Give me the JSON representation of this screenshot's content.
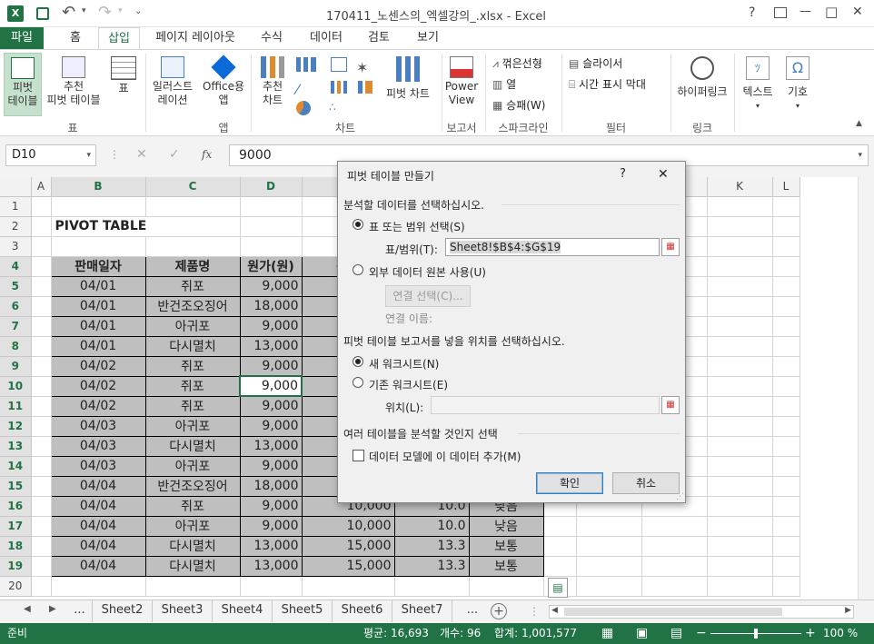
{
  "title_bar": {
    "title": "170411_노센스의_엑셀강의_.xlsx - Excel",
    "help": "?",
    "min": "—",
    "restore": "□",
    "close": "✕"
  },
  "ribbon_tabs": [
    "파일",
    "홈",
    "삽입",
    "페이지 레이아웃",
    "수식",
    "데이터",
    "검토",
    "보기"
  ],
  "ribbon": {
    "pivot_table": [
      "피벗",
      "테이블"
    ],
    "recommended_pivot": [
      "추천",
      "피벗 테이블"
    ],
    "table": "표",
    "illustrations": [
      "일러스트",
      "레이션"
    ],
    "office_apps": [
      "Office용",
      "앱"
    ],
    "recommended_charts": [
      "추천",
      "차트"
    ],
    "pivot_chart": "피벗 차트",
    "power_view": [
      "Power",
      "View"
    ],
    "spark_line": "꺾은선형",
    "spark_column": "열",
    "spark_winloss": "승패(W)",
    "slicer": "슬라이서",
    "timeline": "시간 표시 막대",
    "hyperlink": "하이퍼링크",
    "text": "텍스트",
    "symbol": "기호",
    "group_table": "표",
    "group_apps": "앱",
    "group_charts": "차트",
    "group_reports": "보고서",
    "group_sparklines": "스파크라인",
    "group_filters": "필터",
    "group_links": "링크"
  },
  "formula_bar": {
    "name_box": "D10",
    "fx": "fx",
    "value": "9000"
  },
  "columns": [
    "A",
    "B",
    "C",
    "D",
    "E",
    "F",
    "G",
    "H",
    "I",
    "J",
    "K",
    "L"
  ],
  "rows": [
    "1",
    "2",
    "3",
    "4",
    "5",
    "6",
    "7",
    "8",
    "9",
    "10",
    "11",
    "12",
    "13",
    "14",
    "15",
    "16",
    "17",
    "18",
    "19",
    "20"
  ],
  "sheet_title": "PIVOT TABLE",
  "table_headers": [
    "판매일자",
    "제품명",
    "원가(원)",
    "판매",
    "",
    ""
  ],
  "table_rows": [
    [
      "04/01",
      "쥐포",
      "9,000",
      "",
      "",
      ""
    ],
    [
      "04/01",
      "반건조오징어",
      "18,000",
      "",
      "",
      ""
    ],
    [
      "04/01",
      "아귀포",
      "9,000",
      "",
      "",
      ""
    ],
    [
      "04/01",
      "다시멸치",
      "13,000",
      "",
      "",
      ""
    ],
    [
      "04/02",
      "쥐포",
      "9,000",
      "",
      "",
      ""
    ],
    [
      "04/02",
      "쥐포",
      "9,000",
      "",
      "",
      ""
    ],
    [
      "04/02",
      "쥐포",
      "9,000",
      "",
      "",
      ""
    ],
    [
      "04/03",
      "아귀포",
      "9,000",
      "",
      "",
      ""
    ],
    [
      "04/03",
      "다시멸치",
      "13,000",
      "",
      "",
      ""
    ],
    [
      "04/03",
      "아귀포",
      "9,000",
      "",
      "",
      ""
    ],
    [
      "04/04",
      "반건조오징어",
      "18,000",
      "",
      "",
      ""
    ],
    [
      "04/04",
      "쥐포",
      "9,000",
      "10,000",
      "10.0",
      "낮음"
    ],
    [
      "04/04",
      "아귀포",
      "9,000",
      "10,000",
      "10.0",
      "낮음"
    ],
    [
      "04/04",
      "다시멸치",
      "13,000",
      "15,000",
      "13.3",
      "보통"
    ],
    [
      "04/04",
      "다시멸치",
      "13,000",
      "15,000",
      "13.3",
      "보통"
    ]
  ],
  "sheet_tabs": [
    "...",
    "Sheet2",
    "Sheet3",
    "Sheet4",
    "Sheet5",
    "Sheet6",
    "Sheet7",
    "..."
  ],
  "status_bar": {
    "ready": "준비",
    "average": "평균: 16,693",
    "count": "개수: 96",
    "sum": "합계: 1,001,577",
    "zoom": "100 %"
  },
  "dialog": {
    "title": "피벗 테이블 만들기",
    "help": "?",
    "close": "✕",
    "section1": "분석할 데이터를 선택하십시오.",
    "opt_range": "표 또는 범위 선택(S)",
    "range_label": "표/범위(T):",
    "range_value": "Sheet8!$B$4:$G$19",
    "opt_external": "외부 데이터 원본 사용(U)",
    "choose_conn": "연결 선택(C)...",
    "conn_name": "연결 이름:",
    "section2": "피벗 테이블 보고서를 넣을 위치를 선택하십시오.",
    "opt_new": "새 워크시트(N)",
    "opt_existing": "기존 워크시트(E)",
    "location_label": "위치(L):",
    "location_value": "",
    "section3": "여러 테이블을 분석할 것인지 선택",
    "add_model": "데이터 모델에 이 데이터 추가(M)",
    "ok": "확인",
    "cancel": "취소"
  },
  "colors": {
    "excel_green": "#217346",
    "table_gray": "#bfbfbf",
    "header_gray": "#f2f2f2"
  }
}
